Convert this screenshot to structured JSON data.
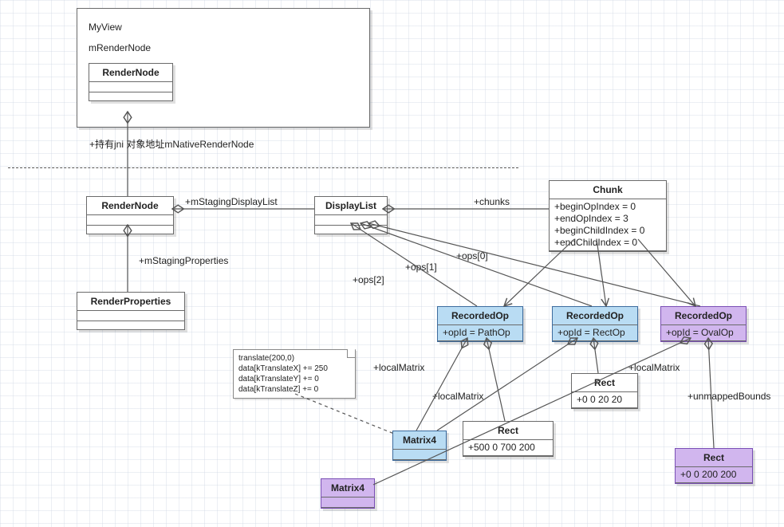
{
  "myview": {
    "title": "MyView",
    "field": "mRenderNode",
    "inner": {
      "name": "RenderNode"
    }
  },
  "labels": {
    "jni": "+持有jni 对象地址mNativeRenderNode",
    "mStagingDisplayList": "+mStagingDisplayList",
    "mStagingProperties": "+mStagingProperties",
    "chunks": "+chunks",
    "ops0": "+ops[0]",
    "ops1": "+ops[1]",
    "ops2": "+ops[2]",
    "localMatrix1": "+localMatrix",
    "localMatrix2": "+localMatrix",
    "localMatrix3": "+localMatrix",
    "unmappedBounds": "+unmappedBounds"
  },
  "classes": {
    "renderNodeJava": {
      "name": "RenderNode"
    },
    "renderNodeNative": {
      "name": "RenderNode"
    },
    "renderProperties": {
      "name": "RenderProperties"
    },
    "displayList": {
      "name": "DisplayList"
    },
    "chunk": {
      "name": "Chunk",
      "attrs": [
        "+beginOpIndex = 0",
        "+endOpIndex = 3",
        "+beginChildIndex = 0",
        "+endChildIndex = 0"
      ]
    },
    "recOpPath": {
      "name": "RecordedOp",
      "attr": "+opId = PathOp"
    },
    "recOpRect": {
      "name": "RecordedOp",
      "attr": "+opId = RectOp"
    },
    "recOpOval": {
      "name": "RecordedOp",
      "attr": "+opId = OvalOp"
    },
    "rect1": {
      "name": "Rect",
      "attr": "+0 0 20 20"
    },
    "rect2": {
      "name": "Rect",
      "attr": "+500 0 700 200"
    },
    "rect3": {
      "name": "Rect",
      "attr": "+0 0 200 200"
    },
    "matrix4a": {
      "name": "Matrix4"
    },
    "matrix4b": {
      "name": "Matrix4"
    }
  },
  "note": {
    "lines": [
      "translate(200,0)",
      "data[kTranslateX] += 250",
      "data[kTranslateY] += 0",
      "data[kTranslateZ] += 0"
    ]
  }
}
